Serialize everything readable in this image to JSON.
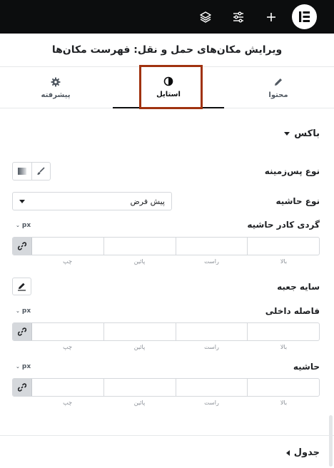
{
  "panel_title": "ویرایش مکان‌های حمل و نقل: فهرست مکان‌ها",
  "topbar": {
    "icons": [
      "layers-icon",
      "sliders-icon",
      "plus-icon",
      "elementor-logo"
    ]
  },
  "tabs": [
    {
      "label": "محتوا",
      "icon": "pencil-icon",
      "active": false
    },
    {
      "label": "استایل",
      "icon": "half-circle-icon",
      "active": true
    },
    {
      "label": "پیشرفته",
      "icon": "gear-icon",
      "active": false
    }
  ],
  "box_section": {
    "title": "باکس",
    "background_type_label": "نوع پس‌زمینه",
    "border_type_label": "نوع حاشیه",
    "border_type_value": "پیش فرض",
    "border_radius_label": "گردی کادر حاشیه",
    "box_shadow_label": "سایه جعبه",
    "padding_label": "فاصله داخلی",
    "margin_label": "حاشیه",
    "unit": "px",
    "sides": {
      "top": "بالا",
      "right": "راست",
      "bottom": "پائین",
      "left": "چپ"
    }
  },
  "table_section": {
    "title": "جدول"
  },
  "colors": {
    "topbar": "#0c0d0e",
    "highlight": "#a0320f"
  }
}
